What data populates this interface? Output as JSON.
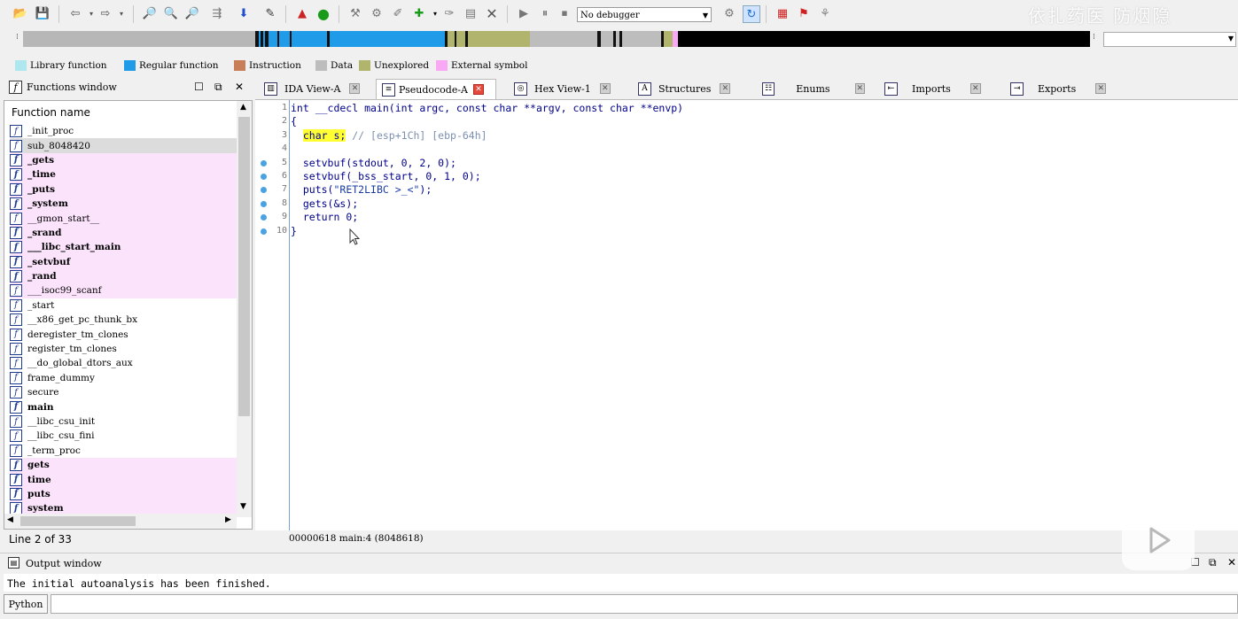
{
  "toolbar": {
    "debugger_select": "No debugger",
    "watermark": "依扎药医 防烟隐"
  },
  "legend": [
    {
      "label": "Library function",
      "color": "#aee8ee"
    },
    {
      "label": "Regular function",
      "color": "#1f9be8"
    },
    {
      "label": "Instruction",
      "color": "#c87f57"
    },
    {
      "label": "Data",
      "color": "#bdbdbd"
    },
    {
      "label": "Unexplored",
      "color": "#b1b46c"
    },
    {
      "label": "External symbol",
      "color": "#f9a8f4"
    }
  ],
  "functions_window": {
    "title": "Functions window",
    "column_header": "Function name",
    "status": "Line 2 of 33",
    "functions": [
      {
        "name": "_init_proc",
        "bold": false,
        "lib": false,
        "selected": false
      },
      {
        "name": "sub_8048420",
        "bold": false,
        "lib": false,
        "selected": true
      },
      {
        "name": "_gets",
        "bold": true,
        "lib": true,
        "selected": false
      },
      {
        "name": "_time",
        "bold": true,
        "lib": true,
        "selected": false
      },
      {
        "name": "_puts",
        "bold": true,
        "lib": true,
        "selected": false
      },
      {
        "name": "_system",
        "bold": true,
        "lib": true,
        "selected": false
      },
      {
        "name": "__gmon_start__",
        "bold": false,
        "lib": true,
        "selected": false
      },
      {
        "name": "_srand",
        "bold": true,
        "lib": true,
        "selected": false
      },
      {
        "name": "___libc_start_main",
        "bold": true,
        "lib": true,
        "selected": false
      },
      {
        "name": "_setvbuf",
        "bold": true,
        "lib": true,
        "selected": false
      },
      {
        "name": "_rand",
        "bold": true,
        "lib": true,
        "selected": false
      },
      {
        "name": "___isoc99_scanf",
        "bold": false,
        "lib": true,
        "selected": false
      },
      {
        "name": "_start",
        "bold": false,
        "lib": false,
        "selected": false
      },
      {
        "name": "__x86_get_pc_thunk_bx",
        "bold": false,
        "lib": false,
        "selected": false
      },
      {
        "name": "deregister_tm_clones",
        "bold": false,
        "lib": false,
        "selected": false
      },
      {
        "name": "register_tm_clones",
        "bold": false,
        "lib": false,
        "selected": false
      },
      {
        "name": "__do_global_dtors_aux",
        "bold": false,
        "lib": false,
        "selected": false
      },
      {
        "name": "frame_dummy",
        "bold": false,
        "lib": false,
        "selected": false
      },
      {
        "name": "secure",
        "bold": false,
        "lib": false,
        "selected": false
      },
      {
        "name": "main",
        "bold": true,
        "lib": false,
        "selected": false
      },
      {
        "name": "__libc_csu_init",
        "bold": false,
        "lib": false,
        "selected": false
      },
      {
        "name": "__libc_csu_fini",
        "bold": false,
        "lib": false,
        "selected": false
      },
      {
        "name": "_term_proc",
        "bold": false,
        "lib": false,
        "selected": false
      },
      {
        "name": "gets",
        "bold": true,
        "lib": true,
        "selected": false
      },
      {
        "name": "time",
        "bold": true,
        "lib": true,
        "selected": false
      },
      {
        "name": "puts",
        "bold": true,
        "lib": true,
        "selected": false
      },
      {
        "name": "system",
        "bold": true,
        "lib": true,
        "selected": false
      }
    ]
  },
  "tabs": [
    {
      "label": "IDA View-A",
      "icon": "ida-view",
      "active": false
    },
    {
      "label": "Pseudocode-A",
      "icon": "pseudocode",
      "active": true
    },
    {
      "label": "Hex View-1",
      "icon": "hex-view",
      "active": false
    },
    {
      "label": "Structures",
      "icon": "structures",
      "active": false
    },
    {
      "label": "Enums",
      "icon": "enums",
      "active": false
    },
    {
      "label": "Imports",
      "icon": "imports",
      "active": false
    },
    {
      "label": "Exports",
      "icon": "exports",
      "active": false
    }
  ],
  "pseudocode": {
    "lines": [
      {
        "num": "1",
        "bp": false,
        "text": "int __cdecl main(int argc, const char **argv, const char **envp)"
      },
      {
        "num": "2",
        "bp": false,
        "text": "{"
      },
      {
        "num": "3",
        "bp": false,
        "hl": "char s;",
        "comment": " // [esp+1Ch] [ebp-64h]"
      },
      {
        "num": "4",
        "bp": false,
        "text": ""
      },
      {
        "num": "5",
        "bp": true,
        "text": "setvbuf(stdout, 0, 2, 0);"
      },
      {
        "num": "6",
        "bp": true,
        "text": "setvbuf(_bss_start, 0, 1, 0);"
      },
      {
        "num": "7",
        "bp": true,
        "pre": "puts(",
        "str": "\"RET2LIBC >_<\"",
        "post": ");"
      },
      {
        "num": "8",
        "bp": true,
        "text": "gets(&s);"
      },
      {
        "num": "9",
        "bp": true,
        "text": "return 0;"
      },
      {
        "num": "10",
        "bp": true,
        "text": "}"
      }
    ],
    "status": "00000618 main:4 (8048618)"
  },
  "output_window": {
    "title": "Output window",
    "message": "The initial autoanalysis has been finished.",
    "python_button": "Python"
  }
}
